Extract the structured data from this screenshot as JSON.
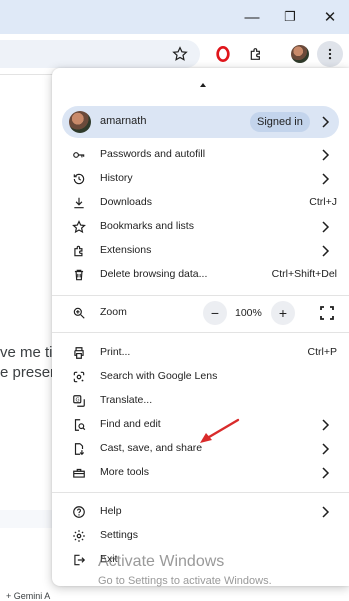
{
  "window": {
    "minimize_glyph": "—",
    "restore_glyph": "❐",
    "close_glyph": "✕"
  },
  "toolbar": {
    "icons": [
      "star-icon",
      "opera-extension-icon",
      "puzzle-extensions-icon",
      "profile-avatar",
      "kebab-menu-icon"
    ]
  },
  "page": {
    "line1": "ve me tip",
    "line2": "e presen",
    "footer_snippet": "+ Gemini A"
  },
  "menu": {
    "profile": {
      "name": "amarnath",
      "status": "Signed in"
    },
    "section1": [
      {
        "icon": "key-icon",
        "label": "Passwords and autofill",
        "shortcut": "",
        "submenu": true
      },
      {
        "icon": "history-icon",
        "label": "History",
        "shortcut": "",
        "submenu": true
      },
      {
        "icon": "download-icon",
        "label": "Downloads",
        "shortcut": "Ctrl+J",
        "submenu": false
      },
      {
        "icon": "star-icon",
        "label": "Bookmarks and lists",
        "shortcut": "",
        "submenu": true
      },
      {
        "icon": "puzzle-icon",
        "label": "Extensions",
        "shortcut": "",
        "submenu": true
      },
      {
        "icon": "trash-icon",
        "label": "Delete browsing data...",
        "shortcut": "Ctrl+Shift+Del",
        "submenu": false
      }
    ],
    "zoom": {
      "label": "Zoom",
      "minus": "−",
      "value": "100%",
      "plus": "+"
    },
    "section3": [
      {
        "icon": "print-icon",
        "label": "Print...",
        "shortcut": "Ctrl+P",
        "submenu": false
      },
      {
        "icon": "lens-icon",
        "label": "Search with Google Lens",
        "shortcut": "",
        "submenu": false
      },
      {
        "icon": "translate-icon",
        "label": "Translate...",
        "shortcut": "",
        "submenu": false
      },
      {
        "icon": "find-icon",
        "label": "Find and edit",
        "shortcut": "",
        "submenu": true
      },
      {
        "icon": "cast-icon",
        "label": "Cast, save, and share",
        "shortcut": "",
        "submenu": true
      },
      {
        "icon": "toolbox-icon",
        "label": "More tools",
        "shortcut": "",
        "submenu": true
      }
    ],
    "section4": [
      {
        "icon": "help-icon",
        "label": "Help",
        "shortcut": "",
        "submenu": true
      },
      {
        "icon": "settings-icon",
        "label": "Settings",
        "shortcut": "",
        "submenu": false
      },
      {
        "icon": "exit-icon",
        "label": "Exit",
        "shortcut": "",
        "submenu": false
      }
    ]
  },
  "watermark": {
    "title": "Activate Windows",
    "subtitle": "Go to Settings to activate Windows."
  },
  "colors": {
    "titlebar": "#dfe9f7",
    "profile_row": "#dbe5f4",
    "annotation_arrow": "#d92b2b"
  }
}
